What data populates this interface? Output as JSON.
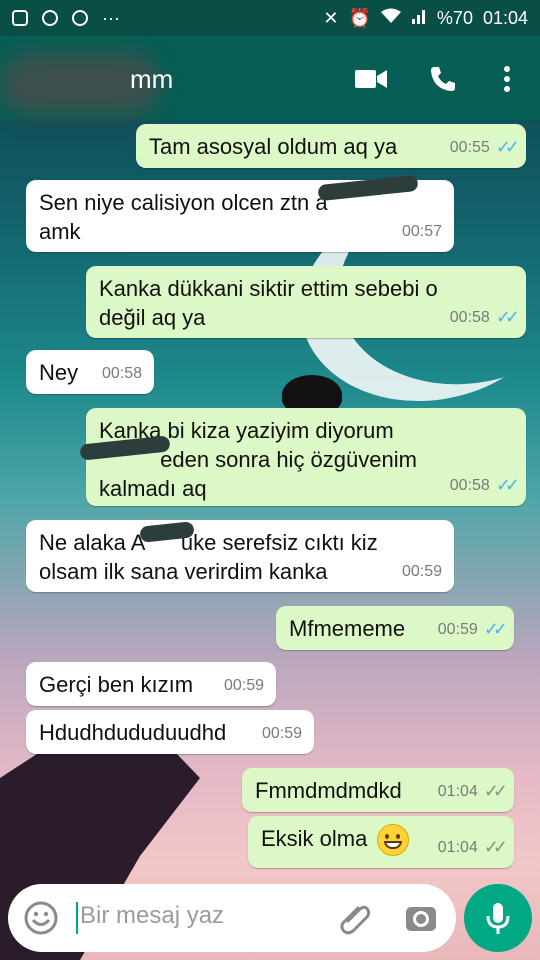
{
  "status_bar": {
    "battery": "%70",
    "time": "01:04",
    "more": "···"
  },
  "header": {
    "contact_name": "mm"
  },
  "messages": [
    {
      "dir": "out",
      "text": "Tam asosyal oldum aq ya",
      "time": "00:55",
      "status": "read"
    },
    {
      "dir": "in",
      "text": "Sen niye calisiyon olcen ztn a\namk",
      "time": "00:57"
    },
    {
      "dir": "out",
      "text": "Kanka dükkani siktir ettim sebebi o\ndeğil aq ya",
      "time": "00:58",
      "status": "read"
    },
    {
      "dir": "in",
      "text": "Ney",
      "time": "00:58"
    },
    {
      "dir": "out",
      "text": "Kanka bi kiza yaziyim diyorum\n          eden sonra hiç özgüvenim\nkalmadı aq",
      "time": "00:58",
      "status": "read"
    },
    {
      "dir": "in",
      "text": "Ne alaka A      uke serefsiz cıktı kiz\nolsam ilk sana verirdim kanka",
      "time": "00:59"
    },
    {
      "dir": "out",
      "text": "Mfmememe",
      "time": "00:59",
      "status": "read"
    },
    {
      "dir": "in",
      "text": "Gerçi ben kızım",
      "time": "00:59"
    },
    {
      "dir": "in",
      "text": "Hdudhdududuudhd",
      "time": "00:59"
    },
    {
      "dir": "out",
      "text": "Fmmdmdmdkd",
      "time": "01:04",
      "status": "sent"
    },
    {
      "dir": "out",
      "text": "Eksik olma",
      "emoji": "grinning-face",
      "time": "01:04",
      "status": "sent"
    }
  ],
  "composer": {
    "placeholder": "Bir mesaj yaz"
  },
  "colors": {
    "header": "#075e54",
    "status_bar": "#0a4f45",
    "outgoing_bubble": "#dcf8c6",
    "incoming_bubble": "#ffffff",
    "read_tick": "#4fb6ec",
    "accent": "#00a884"
  }
}
